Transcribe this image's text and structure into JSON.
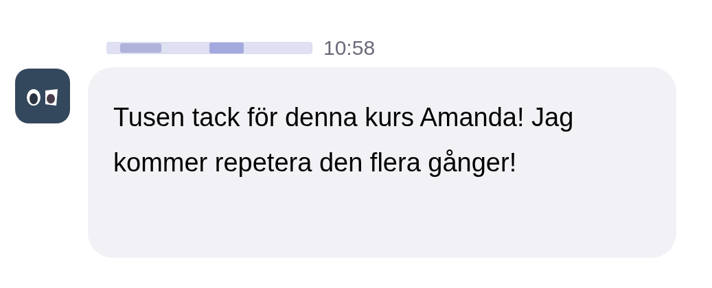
{
  "message": {
    "time": "10:58",
    "text": "Tusen tack för denna kurs Amanda! Jag kommer repetera den flera gånger!"
  }
}
